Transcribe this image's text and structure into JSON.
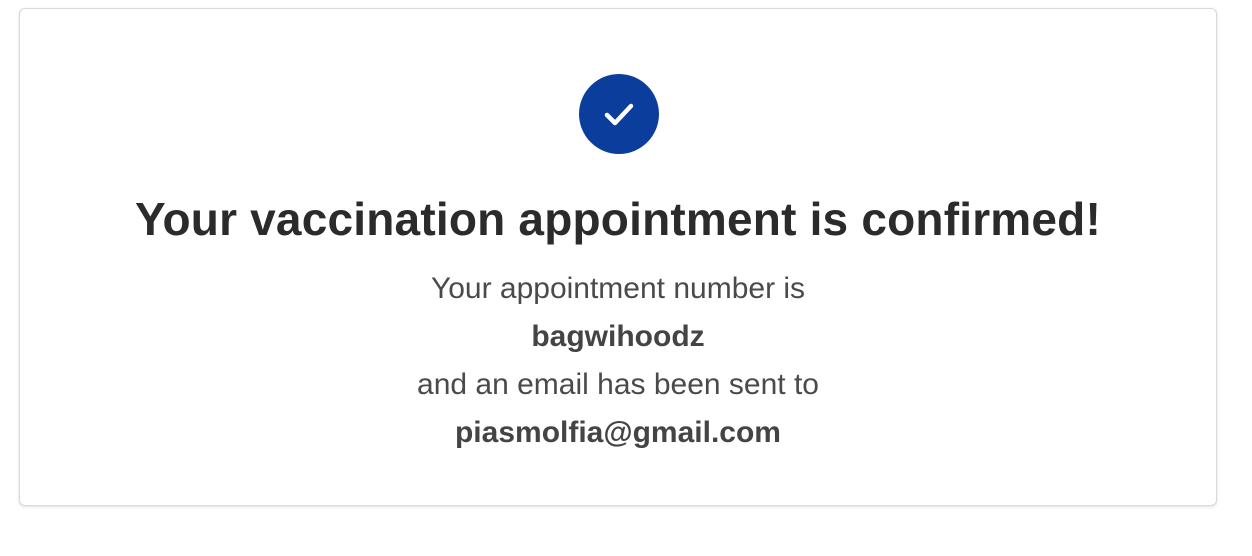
{
  "confirmation": {
    "icon": "check-icon",
    "accent_color": "#0a3d9c",
    "title": "Your vaccination appointment is confirmed!",
    "number_intro": "Your appointment number is",
    "appointment_number": "bagwihoodz",
    "email_intro": "and an email has been sent to",
    "email": "piasmolfia@gmail.com"
  }
}
